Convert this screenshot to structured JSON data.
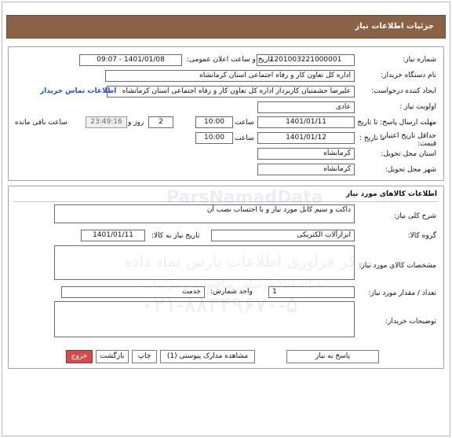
{
  "header": {
    "title": "جزئیات اطلاعات نیاز"
  },
  "tender": {
    "need_number_label": "شماره نیاز:",
    "need_number": "1201003221000001",
    "announce_label": "تاریخ و ساعت اعلان عمومی:",
    "announce_value": "1401/01/08 - 09:07",
    "buyer_org_label": "نام دستگاه خریدار:",
    "buyer_org": "اداره کل تعاون  کار و رفاه اجتماعی استان کرمانشاه",
    "requester_label": "ایجاد کننده درخواست:",
    "requester": "علیرضا حشمتیان کاربرداز اداره کل تعاون  کار و رفاه اجتماعی استان کرمانشاه",
    "contact_link": "اطلاعات تماس خریدار",
    "priority_label": "اولویت نیاز :",
    "priority": "عادی",
    "deadline_label": "مهلت ارسال پاسخ: تا تاریخ :",
    "deadline_date": "1401/01/11",
    "deadline_time_label": "ساعت",
    "deadline_time": "10:00",
    "days_left": "2",
    "days_label": "روز و",
    "time_left": "23:49:16",
    "remaining_label": "ساعت باقی مانده",
    "min_validity_label_1": "حداقل تاریخ اعتبار",
    "min_validity_label_2": "قیمت:",
    "validity_to_label": "تا تاریخ :",
    "validity_date": "1401/01/12",
    "validity_time_label": "ساعت",
    "validity_time": "10:00",
    "province_label": "استان محل تحویل:",
    "province": "کرمانشاه",
    "city_label": "شهر محل تحویل:",
    "city": "کرمانشاه"
  },
  "goods": {
    "section_title": "اطلاعات کالاهای مورد نیاز",
    "summary_label": "شرح کلی نیاز:",
    "summary": "داکت و سیم کابل مورد نیاز و با احتساب نصب آن",
    "group_label": "گروه کالا:",
    "group": "ابزارآلات الکتریکی",
    "need_date_label": "تاریخ نیاز به کالا:",
    "need_date": "1401/01/11",
    "specs_label": "مشخصات کالای مورد نیاز:",
    "qty_label": "تعداد / مقدار مورد نیاز:",
    "qty": "1",
    "unit_label": "واحد شمارش:",
    "unit": "خدمت",
    "notes_label": "توضیحات خریدار:"
  },
  "buttons": {
    "reply": "پاسخ به نیاز",
    "attachments": "مشاهده مدارک پیوستی (1)",
    "print": "چاپ",
    "back": "بازگشت",
    "exit": "خروج"
  },
  "watermark": {
    "brand": "ParsNamadData",
    "line1": "مرکز فرآوری اطلاعات پارس نماد داده",
    "line2": "پایگاه اطلاع رسانی مناقصات و مزایدات",
    "phone": "۰۲۱-۸۸۳۴۹۶۷۰-۵"
  },
  "colors": {
    "header_bg": "#8a6248",
    "link": "#1b4fd8",
    "exit_button": "#d64a4a"
  }
}
